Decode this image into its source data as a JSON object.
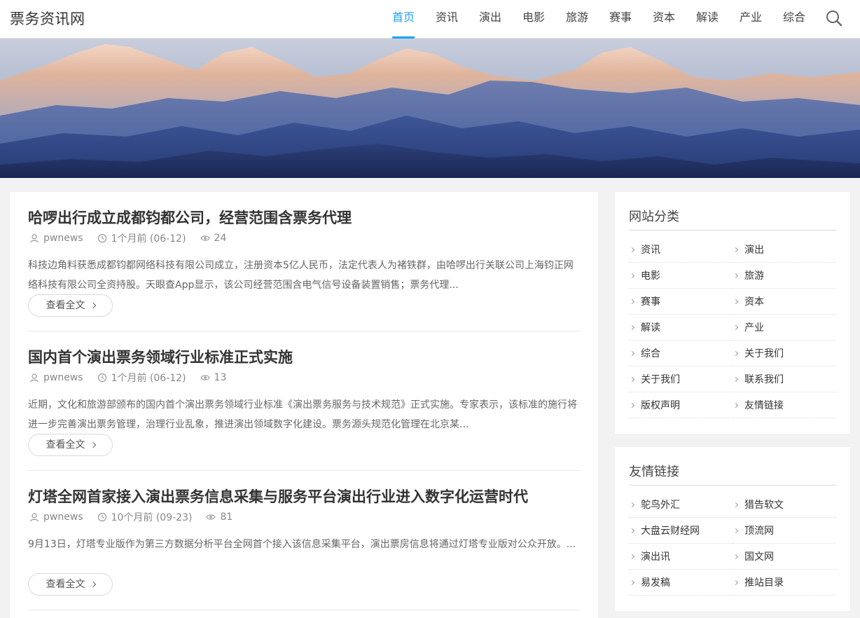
{
  "site": {
    "logo": "票务资讯网"
  },
  "nav": [
    {
      "label": "首页",
      "active": true
    },
    {
      "label": "资讯"
    },
    {
      "label": "演出"
    },
    {
      "label": "电影"
    },
    {
      "label": "旅游"
    },
    {
      "label": "赛事"
    },
    {
      "label": "资本"
    },
    {
      "label": "解读"
    },
    {
      "label": "产业"
    },
    {
      "label": "综合"
    }
  ],
  "posts": [
    {
      "title": "哈啰出行成立成都钧都公司，经营范围含票务代理",
      "author": "pwnews",
      "time": "1个月前 (06-12)",
      "views": "24",
      "excerpt": "科技边角料获悉成都钧都网络科技有限公司成立，注册资本5亿人民币，法定代表人为褚铁群，由哈啰出行关联公司上海钧正网络科技有限公司全资持股。天眼查App显示，该公司经营范围含电气信号设备装置销售；票务代理...",
      "read_more": "查看全文"
    },
    {
      "title": "国内首个演出票务领域行业标准正式实施",
      "author": "pwnews",
      "time": "1个月前 (06-12)",
      "views": "13",
      "excerpt": "近期，文化和旅游部颁布的国内首个演出票务领域行业标准《演出票务服务与技术规范》正式实施。专家表示，该标准的施行将进一步完善演出票务管理，治理行业乱象，推进演出领域数字化建设。票务源头规范化管理在北京某...",
      "read_more": "查看全文"
    },
    {
      "title": "灯塔全网首家接入演出票务信息采集与服务平台演出行业进入数字化运营时代",
      "author": "pwnews",
      "time": "10个月前 (09-23)",
      "views": "81",
      "excerpt": "9月13日，灯塔专业版作为第三方数据分析平台全网首个接入该信息采集平台，演出票房信息将通过灯塔专业版对公众开放。...",
      "read_more": "查看全文"
    }
  ],
  "sidebar": {
    "categories": {
      "title": "网站分类",
      "items": [
        "资讯",
        "演出",
        "电影",
        "旅游",
        "赛事",
        "资本",
        "解读",
        "产业",
        "综合",
        "关于我们",
        "关于我们",
        "联系我们",
        "版权声明",
        "友情链接"
      ]
    },
    "links": {
      "title": "友情链接",
      "items": [
        "鸵鸟外汇",
        "猎告软文",
        "大盘云财经网",
        "顶流网",
        "演出讯",
        "国文网",
        "易发稿",
        "推站目录"
      ]
    }
  },
  "colors": {
    "accent": "#1e9fff",
    "background": "#f2f2f2"
  }
}
